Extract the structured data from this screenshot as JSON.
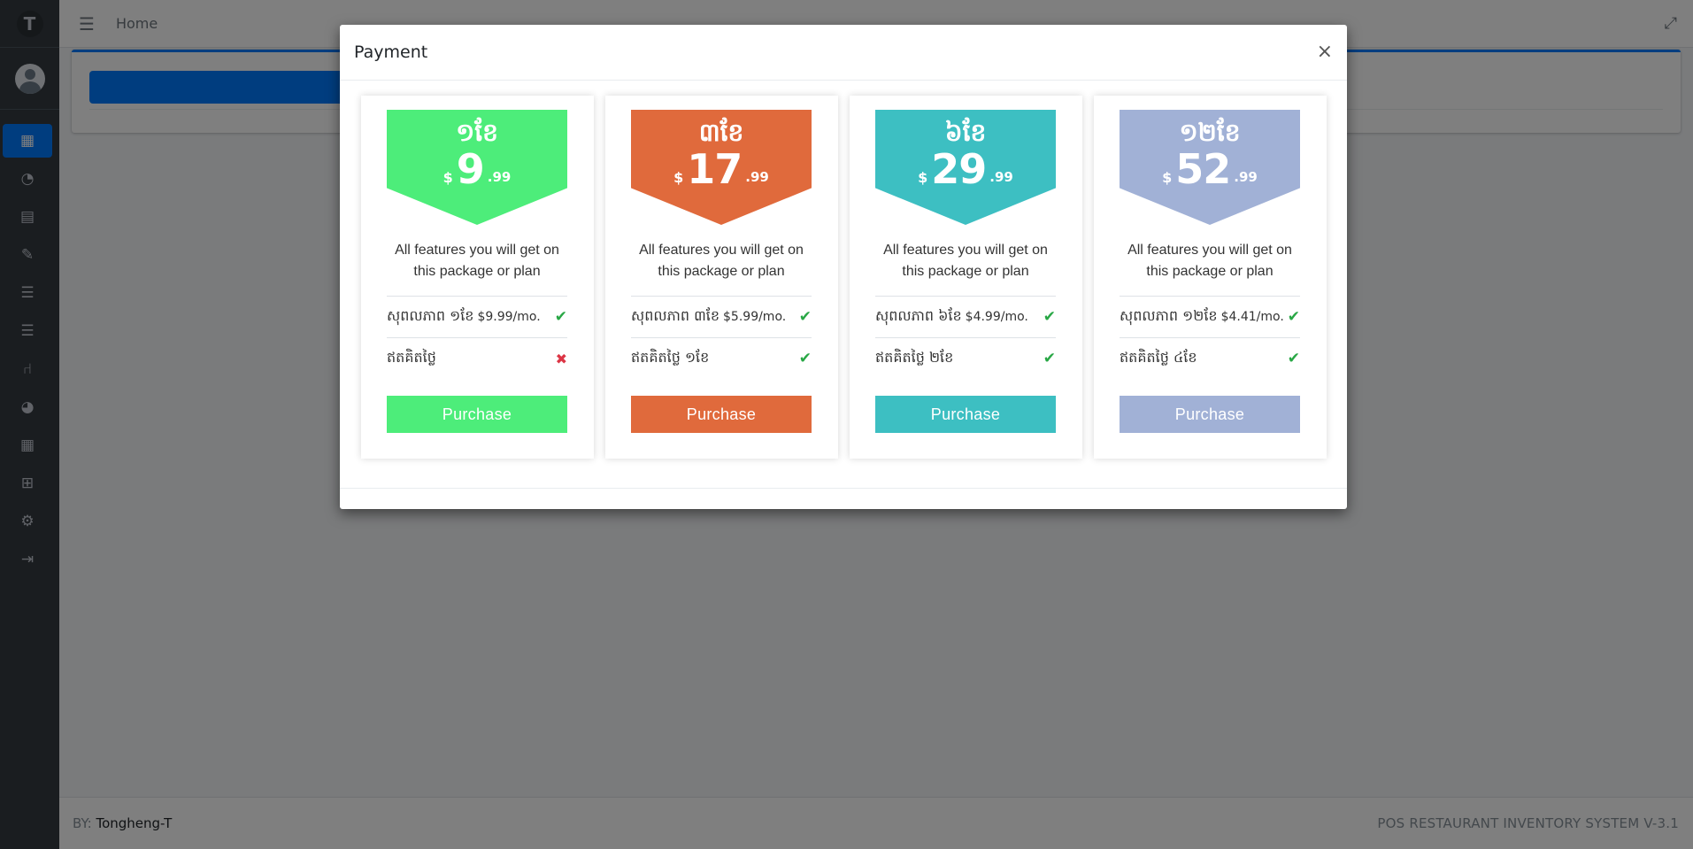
{
  "brand": {
    "logo_glyph": "T"
  },
  "navbar": {
    "menu_icon": "☰",
    "home_label": "Home",
    "fullscreen_icon": "⤢"
  },
  "sidebar": {
    "items": [
      {
        "icon": "cash-register-icon",
        "glyph": "▦",
        "active": true
      },
      {
        "icon": "dashboard-icon",
        "glyph": "◔"
      },
      {
        "icon": "table-icon",
        "glyph": "▤"
      },
      {
        "icon": "edit-icon",
        "glyph": "✎"
      },
      {
        "icon": "list-icon",
        "glyph": "☰"
      },
      {
        "icon": "list-icon",
        "glyph": "☰"
      },
      {
        "icon": "chair-icon",
        "glyph": "⑁"
      },
      {
        "icon": "pie-chart-icon",
        "glyph": "◕"
      },
      {
        "icon": "calculator-icon",
        "glyph": "▦"
      },
      {
        "icon": "plus-square-icon",
        "glyph": "⊞"
      },
      {
        "icon": "gear-icon",
        "glyph": "⚙"
      },
      {
        "icon": "sign-out-icon",
        "glyph": "⇥"
      }
    ]
  },
  "footer": {
    "prefix": "BY: ",
    "author": "Tongheng-T",
    "system_name": "POS RESTAURANT INVENTORY SYSTEM V-3.1"
  },
  "modal": {
    "title": "Payment",
    "close": "×",
    "plans": [
      {
        "duration": "១ខែ",
        "currency": "$",
        "amount": "9",
        "cents": ".99",
        "color": "#4ded7a",
        "description": "All features you will get on this package or plan",
        "features": [
          {
            "label": "សុពលភាព ១ខែ",
            "sub": "$9.99/mo.",
            "status": "check"
          },
          {
            "label": "ឥតគិតថ្លៃ",
            "sub": "",
            "status": "cross"
          }
        ],
        "button": "Purchase"
      },
      {
        "duration": "៣ខែ",
        "currency": "$",
        "amount": "17",
        "cents": ".99",
        "color": "#e06a3c",
        "description": "All features you will get on this package or plan",
        "features": [
          {
            "label": "សុពលភាព ៣ខែ",
            "sub": "$5.99/mo.",
            "status": "check"
          },
          {
            "label": "ឥតគិតថ្លៃ ១ខែ",
            "sub": "",
            "status": "check"
          }
        ],
        "button": "Purchase"
      },
      {
        "duration": "៦ខែ",
        "currency": "$",
        "amount": "29",
        "cents": ".99",
        "color": "#3dbfc2",
        "description": "All features you will get on this package or plan",
        "features": [
          {
            "label": "សុពលភាព ៦ខែ",
            "sub": "$4.99/mo.",
            "status": "check"
          },
          {
            "label": "ឥតគិតថ្លៃ ២ខែ",
            "sub": "",
            "status": "check"
          }
        ],
        "button": "Purchase"
      },
      {
        "duration": "១២ខែ",
        "currency": "$",
        "amount": "52",
        "cents": ".99",
        "color": "#a1b1d6",
        "description": "All features you will get on this package or plan",
        "features": [
          {
            "label": "សុពលភាព ១២ខែ",
            "sub": "$4.41/mo.",
            "status": "check"
          },
          {
            "label": "ឥតគិតថ្លៃ ៤ខែ",
            "sub": "",
            "status": "check"
          }
        ],
        "button": "Purchase"
      }
    ]
  }
}
